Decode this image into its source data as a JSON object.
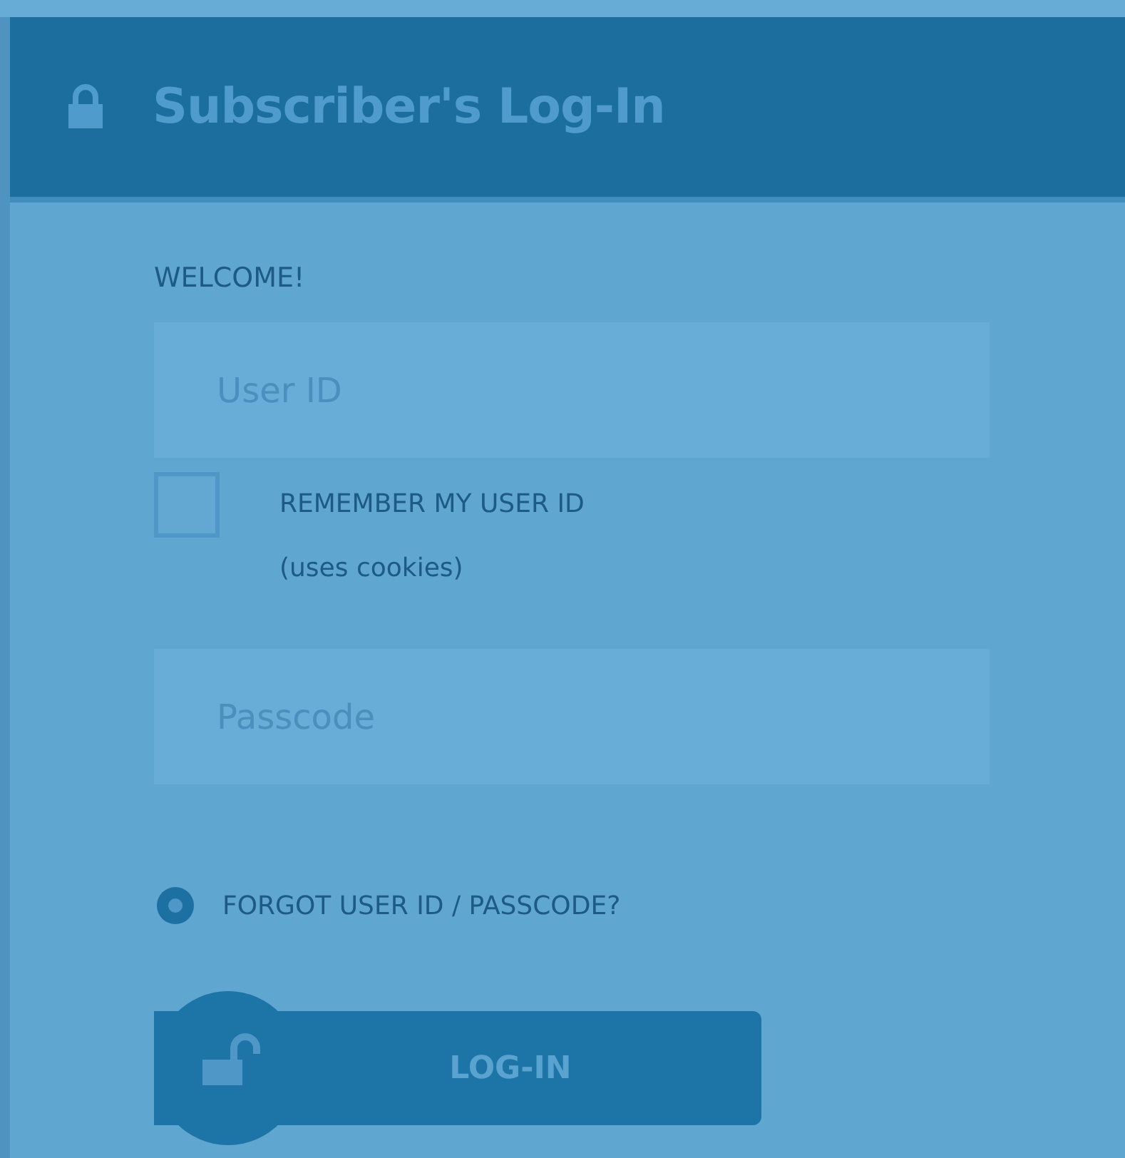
{
  "panel": {
    "title": "Subscriber's Log-In"
  },
  "greeting": "WELCOME!",
  "user_id": {
    "placeholder": "User ID"
  },
  "remember": {
    "label": "REMEMBER MY USER ID",
    "note": "(uses cookies)",
    "checked": false
  },
  "passcode": {
    "placeholder": "Passcode"
  },
  "forgot_link": "FORGOT USER ID / PASSCODE?",
  "login_button": "LOG-IN"
}
